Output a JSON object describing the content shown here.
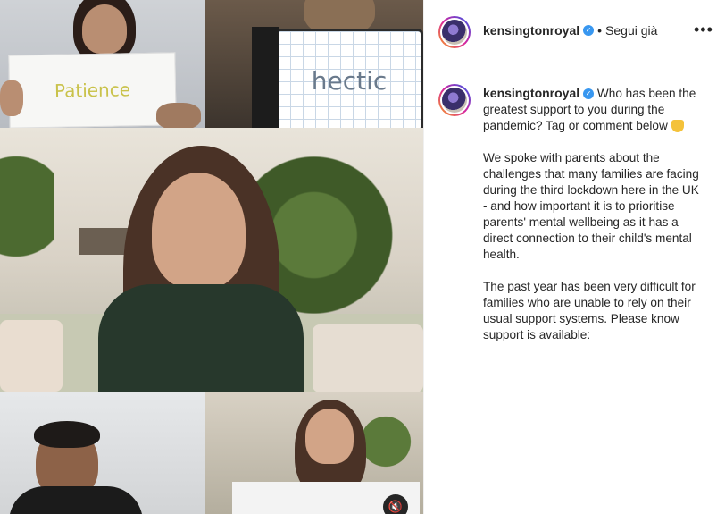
{
  "post": {
    "username": "kensingtonroyal",
    "follow_status": "Segui già",
    "separator": "•",
    "more_icon": "more-icon"
  },
  "media": {
    "sign_left": "Patience",
    "sign_right": "hectic",
    "mute_icon": "volume-mute-icon"
  },
  "caption": {
    "username": "kensingtonroyal",
    "line1": "Who has been the greatest support to you during the pandemic? Tag or comment below",
    "emoji_icon": "pointing-down-emoji",
    "para2": "We spoke with parents about the challenges that many families are facing during the third lockdown here in the UK - and how important it is to prioritise parents' mental wellbeing as it has a direct connection to their child's mental health.",
    "para3": "The past year has been very difficult for families who are unable to rely on their usual support systems. Please know support is available:"
  },
  "colors": {
    "verified": "#3897f0",
    "text": "#262626",
    "ring_start": "#f9a01b",
    "ring_end": "#d6249f"
  }
}
